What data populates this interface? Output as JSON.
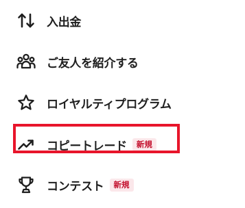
{
  "menu": {
    "items": [
      {
        "label": "入出金",
        "icon": "deposit-withdraw-arrows-icon"
      },
      {
        "label": "ご友人を紹介する",
        "icon": "friends-group-icon"
      },
      {
        "label": "ロイヤルティプログラム",
        "icon": "star-icon"
      },
      {
        "label": "コピートレード",
        "icon": "trending-up-icon",
        "badge": "新規",
        "highlighted": true
      },
      {
        "label": "コンテスト",
        "icon": "trophy-icon",
        "badge": "新規"
      }
    ]
  },
  "colors": {
    "text": "#1e1e1e",
    "badge_background": "#fbe7ea",
    "badge_text": "#c4122f",
    "highlight_border": "#e8152b"
  }
}
